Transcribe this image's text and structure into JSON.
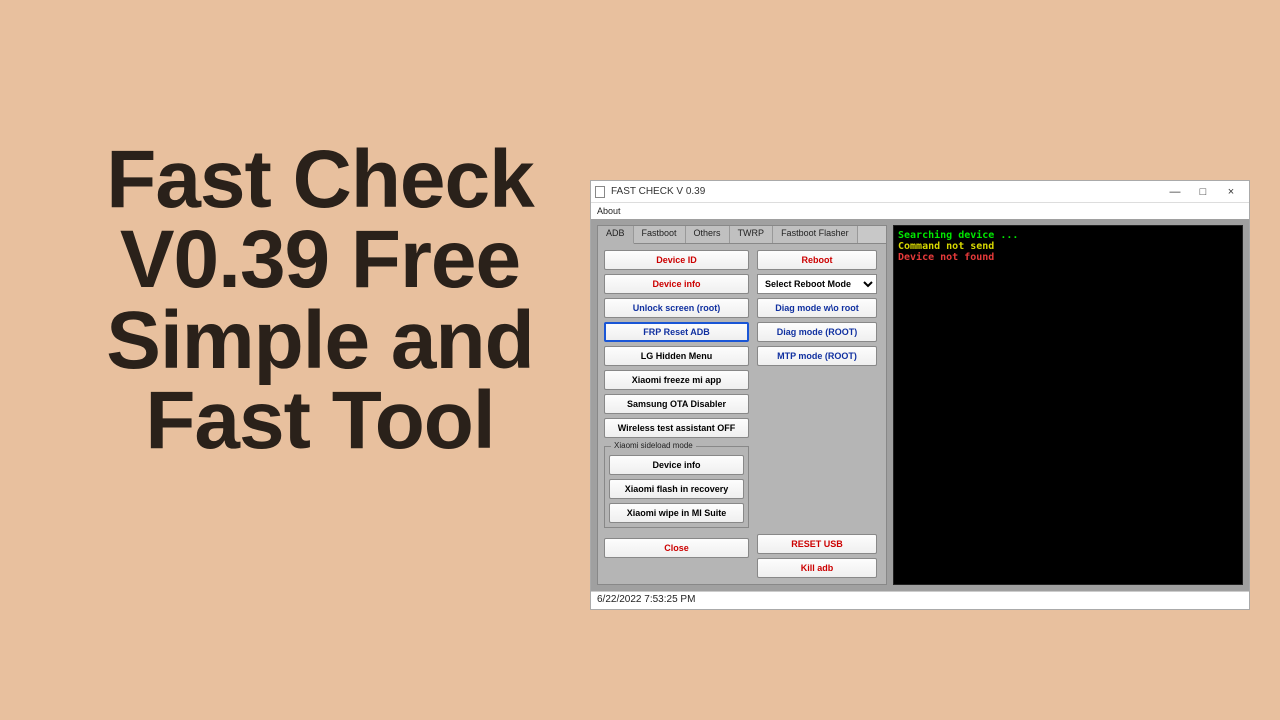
{
  "headline": "Fast Check V0.39 Free Simple and Fast Tool",
  "window": {
    "title": "FAST CHECK    V 0.39",
    "menu": {
      "about": "About"
    },
    "win_controls": {
      "min": "—",
      "max": "□",
      "close": "×"
    }
  },
  "tabs": [
    "ADB",
    "Fastboot",
    "Others",
    "TWRP",
    "Fastboot Flasher"
  ],
  "col1": {
    "device_id": "Device ID",
    "device_info": "Device info",
    "unlock_screen": "Unlock screen (root)",
    "frp_reset": "FRP Reset ADB",
    "lg_hidden": "LG Hidden Menu",
    "xiaomi_freeze": "Xiaomi freeze mi app",
    "samsung_ota": "Samsung OTA Disabler",
    "wireless_off": "Wireless test assistant OFF"
  },
  "sideload": {
    "legend": "Xiaomi sideload mode",
    "device_info": "Device info",
    "flash_recovery": "Xiaomi flash in recovery",
    "wipe_suite": "Xiaomi wipe in MI Suite"
  },
  "close_btn": "Close",
  "col2": {
    "reboot": "Reboot",
    "reboot_mode_select": "Select Reboot Mode",
    "diag_noroot": "Diag mode w\\o root",
    "diag_root": "Diag mode (ROOT)",
    "mtp_root": "MTP mode (ROOT)",
    "reset_usb": "RESET USB",
    "kill_adb": "Kill adb"
  },
  "console": {
    "line1": "Searching device ...",
    "line2": "Command not send",
    "line3": "Device  not found"
  },
  "statusbar": "6/22/2022 7:53:25 PM"
}
